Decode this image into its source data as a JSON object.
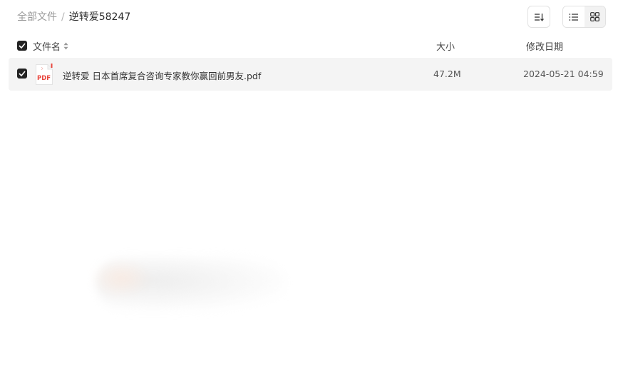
{
  "breadcrumb": {
    "root": "全部文件",
    "separator": "/",
    "current": "逆转爱58247"
  },
  "toolbar": {
    "sort_icon": "sort-list-icon",
    "list_view_icon": "list-view-icon",
    "grid_view_icon": "grid-view-icon"
  },
  "table": {
    "columns": {
      "name": "文件名",
      "size": "大小",
      "date": "修改日期"
    },
    "rows": [
      {
        "icon": "pdf-file-icon",
        "icon_label": "PDF",
        "name": "逆转爱 日本首席复合咨询专家教你赢回前男友.pdf",
        "size": "47.2M",
        "modified": "2024-05-21 04:59",
        "checked": true
      }
    ]
  },
  "colors": {
    "row_highlight": "#f4f4f4",
    "pdf_red": "#e8453c",
    "checkbox": "#222222"
  }
}
